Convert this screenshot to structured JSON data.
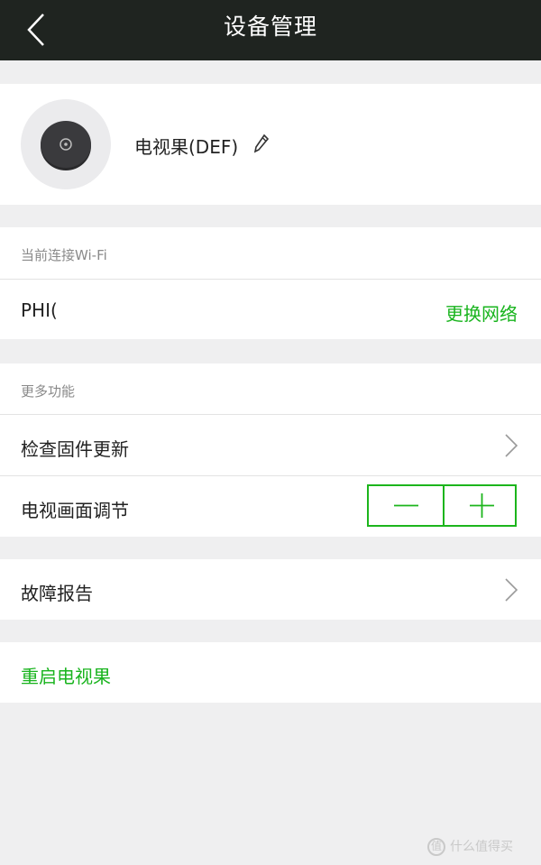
{
  "header": {
    "title": "设备管理"
  },
  "device": {
    "name": "电视果(DEF)"
  },
  "wifi": {
    "section_label": "当前连接Wi-Fi",
    "ssid": "PHI(",
    "change_label": "更换网络"
  },
  "more": {
    "section_label": "更多功能",
    "firmware_label": "检查固件更新",
    "picture_label": "电视画面调节"
  },
  "report": {
    "label": "故障报告"
  },
  "restart": {
    "label": "重启电视果"
  },
  "watermark": {
    "text": "什么值得买",
    "logo_char": "值"
  },
  "colors": {
    "accent": "#19b41e",
    "topbar": "#1f2420",
    "background": "#efeff0"
  },
  "icons": [
    "back-arrow-icon",
    "device-icon",
    "pencil-icon",
    "chevron-right-icon",
    "minus-icon",
    "plus-icon"
  ]
}
